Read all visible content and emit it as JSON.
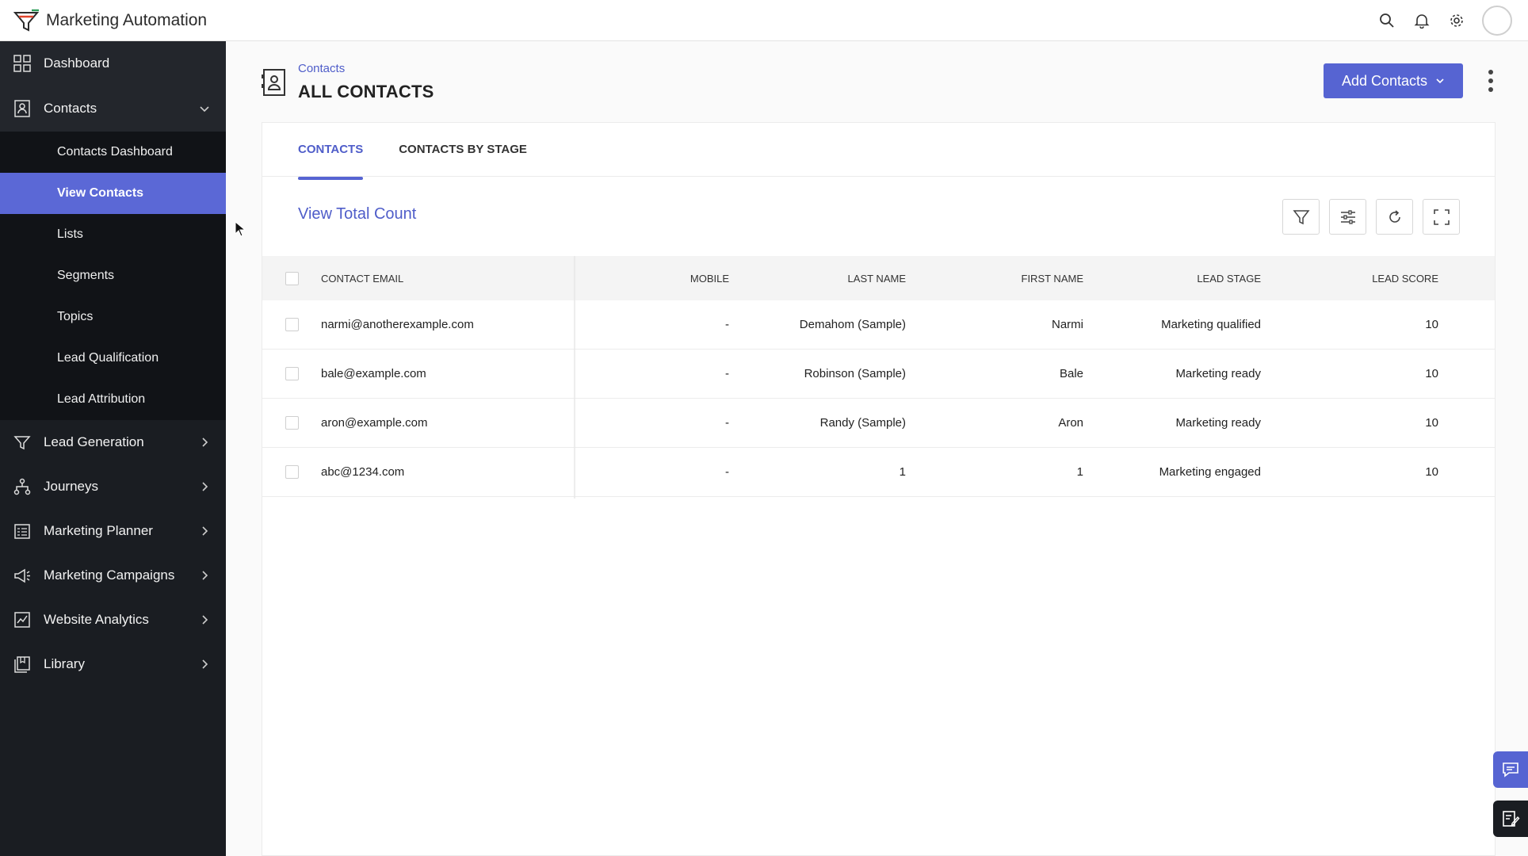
{
  "app": {
    "title": "Marketing Automation"
  },
  "sidebar": {
    "items": [
      {
        "label": "Dashboard",
        "icon": "dashboard-grid-icon"
      },
      {
        "label": "Contacts",
        "icon": "contacts-icon"
      },
      {
        "label": "Lead Generation",
        "icon": "lead-generation-icon"
      },
      {
        "label": "Journeys",
        "icon": "journeys-icon"
      },
      {
        "label": "Marketing Planner",
        "icon": "planner-icon"
      },
      {
        "label": "Marketing Campaigns",
        "icon": "megaphone-icon"
      },
      {
        "label": "Website Analytics",
        "icon": "analytics-icon"
      },
      {
        "label": "Library",
        "icon": "library-icon"
      }
    ],
    "contacts_sub": [
      {
        "label": "Contacts Dashboard"
      },
      {
        "label": "View Contacts"
      },
      {
        "label": "Lists"
      },
      {
        "label": "Segments"
      },
      {
        "label": "Topics"
      },
      {
        "label": "Lead Qualification"
      },
      {
        "label": "Lead Attribution"
      }
    ]
  },
  "page": {
    "breadcrumb": "Contacts",
    "title": "ALL CONTACTS",
    "add_button": "Add Contacts"
  },
  "tabs": [
    {
      "label": "CONTACTS",
      "active": true
    },
    {
      "label": "CONTACTS BY STAGE",
      "active": false
    }
  ],
  "toolbar": {
    "view_total_count": "View Total Count"
  },
  "table": {
    "headers": {
      "email": "CONTACT EMAIL",
      "mobile": "MOBILE",
      "last_name": "LAST NAME",
      "first_name": "FIRST NAME",
      "lead_stage": "LEAD STAGE",
      "lead_score": "LEAD SCORE"
    },
    "rows": [
      {
        "email": "narmi@anotherexample.com",
        "mobile": "-",
        "last_name": "Demahom (Sample)",
        "first_name": "Narmi",
        "lead_stage": "Marketing qualified",
        "lead_score": "10"
      },
      {
        "email": "bale@example.com",
        "mobile": "-",
        "last_name": "Robinson (Sample)",
        "first_name": "Bale",
        "lead_stage": "Marketing ready",
        "lead_score": "10"
      },
      {
        "email": "aron@example.com",
        "mobile": "-",
        "last_name": "Randy (Sample)",
        "first_name": "Aron",
        "lead_stage": "Marketing ready",
        "lead_score": "10"
      },
      {
        "email": "abc@1234.com",
        "mobile": "-",
        "last_name": "1",
        "first_name": "1",
        "lead_stage": "Marketing engaged",
        "lead_score": "10"
      }
    ]
  },
  "colors": {
    "accent": "#5664d2",
    "sidebar_bg": "#1a1d22",
    "active_item": "#5b68d6"
  }
}
